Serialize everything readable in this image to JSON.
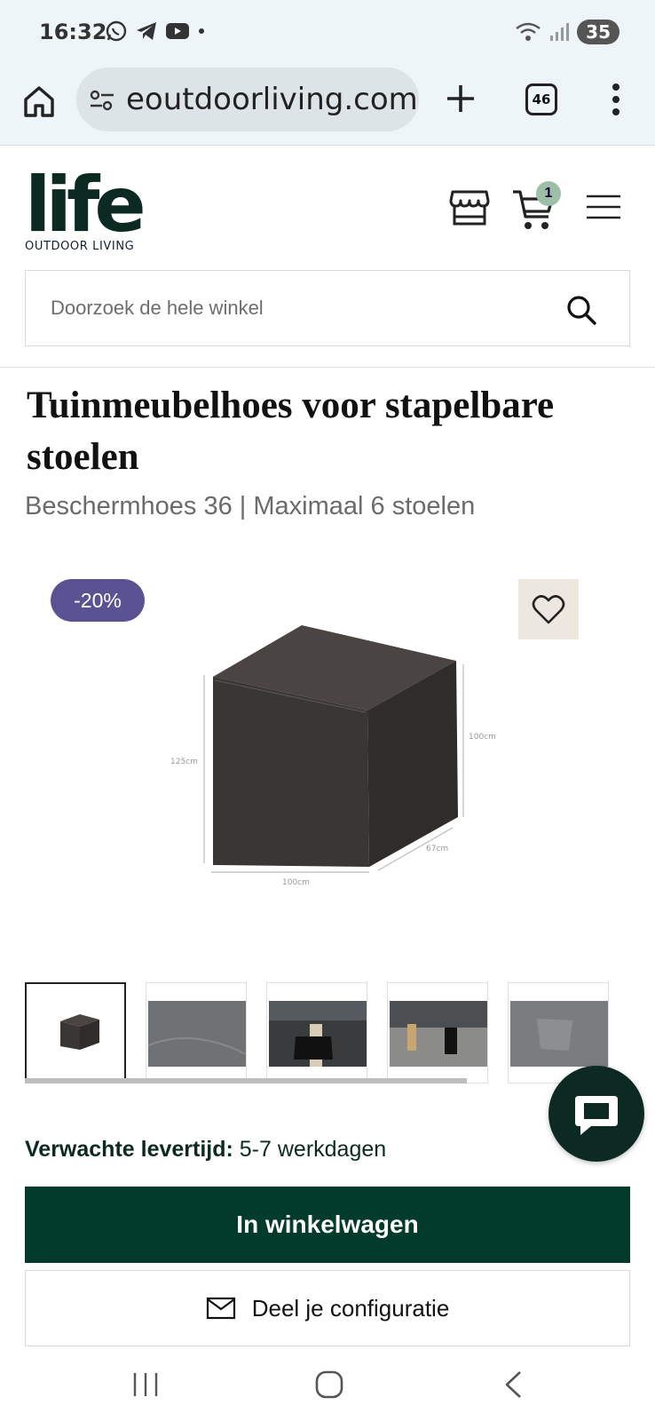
{
  "status_bar": {
    "time": "16:32",
    "battery": "35",
    "icons": [
      "whatsapp-icon",
      "telegram-icon",
      "youtube-icon",
      "dot-icon",
      "wifi-icon",
      "signal-icon"
    ]
  },
  "browser": {
    "url": "eoutdoorliving.com",
    "tab_count": "46"
  },
  "header": {
    "logo_text": "life",
    "logo_subtitle": "OUTDOOR LIVING",
    "cart_count": "1"
  },
  "search": {
    "placeholder": "Doorzoek de hele winkel"
  },
  "product": {
    "title": "Tuinmeubelhoes voor stapelbare stoelen",
    "subtitle": "Beschermhoes 36 | Maximaal 6 stoelen",
    "discount_badge": "-20%",
    "dimensions": {
      "height_left": "125cm",
      "height_right": "100cm",
      "depth": "67cm",
      "width": "100cm"
    },
    "thumbnails": [
      "thumb-1",
      "thumb-2",
      "thumb-3",
      "thumb-4",
      "thumb-5"
    ]
  },
  "delivery": {
    "label": "Verwachte levertijd:",
    "value": "5-7 werkdagen"
  },
  "actions": {
    "add_to_cart": "In winkelwagen",
    "share": "Deel je configuratie"
  },
  "colors": {
    "brand_dark": "#033b2a",
    "badge_purple": "#5a5293",
    "wishlist_bg": "#ece7df",
    "cart_badge": "#9cbfa6"
  }
}
